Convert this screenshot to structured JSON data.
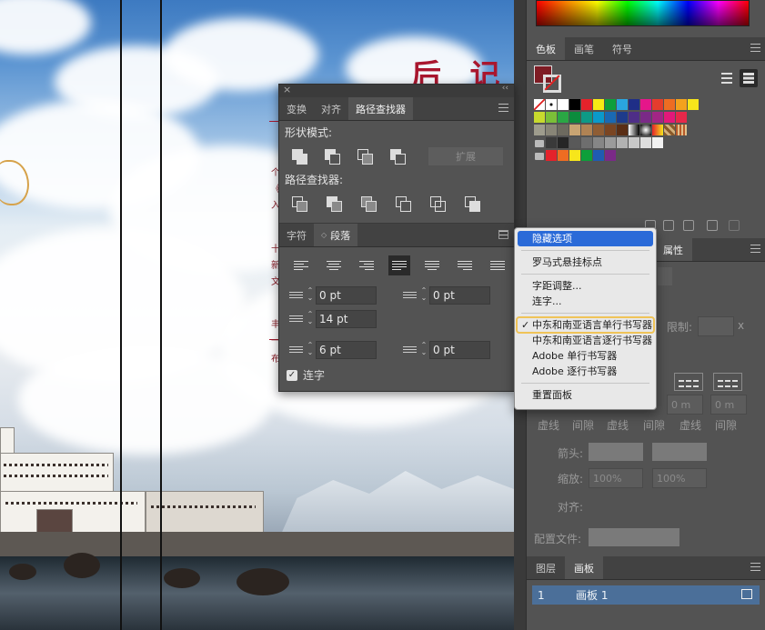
{
  "artwork": {
    "title": "后 记",
    "side_chars": [
      "个",
      "《",
      "入",
      "十",
      "新",
      "文",
      "丰",
      "一",
      "布"
    ]
  },
  "pathfinder_panel": {
    "tabs": [
      "变换",
      "对齐",
      "路径查找器"
    ],
    "shape_modes_label": "形状模式:",
    "expand_label": "扩展",
    "pathfinders_label": "路径查找器:"
  },
  "paragraph_panel": {
    "tabs": [
      "字符",
      "段落"
    ],
    "left_indent": "0 pt",
    "right_indent": "0 pt",
    "first_line_indent": "14 pt",
    "space_before": "6 pt",
    "space_after": "0 pt",
    "hyphenate_label": "连字",
    "hyphenate_checked": true
  },
  "flyout_menu": {
    "items": [
      {
        "label": "隐藏选项",
        "highlighted": true
      },
      {
        "sep": true
      },
      {
        "label": "罗马式悬挂标点"
      },
      {
        "sep": true
      },
      {
        "label": "字距调整..."
      },
      {
        "label": "连字..."
      },
      {
        "sep": true
      },
      {
        "label": "中东和南亚语言单行书写器",
        "checked": true,
        "boxed": true
      },
      {
        "label": "中东和南亚语言逐行书写器"
      },
      {
        "label": "Adobe 单行书写器"
      },
      {
        "label": "Adobe 逐行书写器"
      },
      {
        "sep": true
      },
      {
        "label": "重置面板"
      }
    ]
  },
  "swatches_panel": {
    "tabs": [
      "色板",
      "画笔",
      "符号"
    ],
    "rows": [
      [
        "none",
        "reg",
        "#ffffff",
        "#000000",
        "#e4222b",
        "#f6eb14",
        "#0e9f3a",
        "#2aa5df",
        "#1f2e87",
        "#e5168a",
        "#e53c2d",
        "#ee6d22",
        "#f3a21d",
        "#f7e61b"
      ],
      [
        "#c8da2d",
        "#7bbf38",
        "#2aa744",
        "#0b8c3d",
        "#0d9a86",
        "#0a9acb",
        "#1a69b3",
        "#1e3b8b",
        "#4e2e87",
        "#7a2a87",
        "#a22585",
        "#e2187a",
        "#e7284a"
      ],
      [
        "#9e9c8d",
        "#888577",
        "#6d6a5f",
        "#c8a473",
        "#b08354",
        "#8f5d34",
        "#7a4522",
        "#5a2e15",
        "grad1",
        "grad2",
        "grad3",
        "grad4",
        "grad5"
      ],
      [
        "folder",
        "#3a3a3a",
        "#262626",
        "#595959",
        "#6e6e6e",
        "#868686",
        "#9b9b9b",
        "#b2b2b2",
        "#c8c8c8",
        "#dedede",
        "#f2f2f2"
      ],
      [
        "folder",
        "#e4222b",
        "#ee6d22",
        "#f7e61b",
        "#0e9f3a",
        "#1f5cb2",
        "#7a2a87"
      ]
    ],
    "fill_color": "#7e1c24"
  },
  "properties_panel": {
    "tab_fragment": "属性",
    "limit_label": "限制:",
    "x_label": "x",
    "dash_label": "虚线",
    "gap_label": "间隙",
    "arrow_label": "箭头:",
    "scale_label": "缩放:",
    "scale_value_1": "100%",
    "scale_value_2": "100%",
    "align_label": "对齐:",
    "profile_label": "配置文件:",
    "zero_1": "0 m",
    "zero_2": "0 m"
  },
  "layers_panel": {
    "tabs": [
      "图层",
      "画板"
    ],
    "artboard_num": "1",
    "artboard_name": "画板 1"
  },
  "colors": {
    "accent_red": "#a9172f",
    "menu_highlight": "#2a6ad8",
    "boxed_outline": "#efc358",
    "artboard_selected": "#4b6f99"
  }
}
